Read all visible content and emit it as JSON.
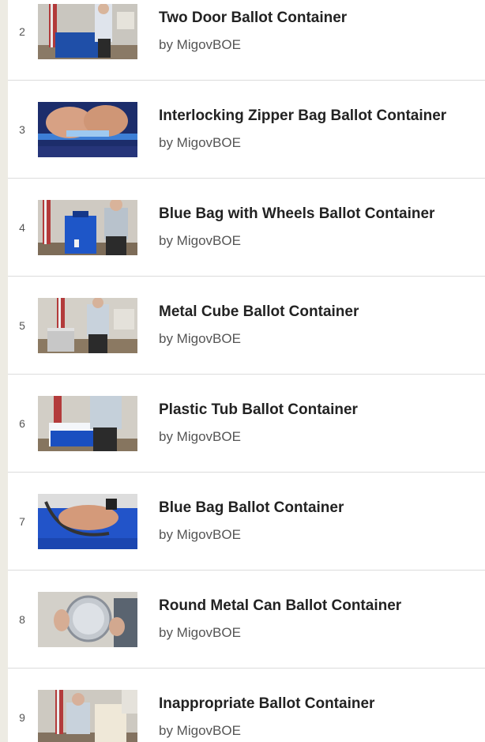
{
  "playlist": {
    "items": [
      {
        "index": "2",
        "title": "Two Door Ballot Container",
        "author": "by MigovBOE",
        "thumb": "two-door-thumbnail"
      },
      {
        "index": "3",
        "title": "Interlocking Zipper Bag Ballot Container",
        "author": "by MigovBOE",
        "thumb": "zipper-bag-thumbnail"
      },
      {
        "index": "4",
        "title": "Blue Bag with Wheels Ballot Container",
        "author": "by MigovBOE",
        "thumb": "blue-bag-wheels-thumbnail"
      },
      {
        "index": "5",
        "title": "Metal Cube Ballot Container",
        "author": "by MigovBOE",
        "thumb": "metal-cube-thumbnail"
      },
      {
        "index": "6",
        "title": "Plastic Tub Ballot Container",
        "author": "by MigovBOE",
        "thumb": "plastic-tub-thumbnail"
      },
      {
        "index": "7",
        "title": "Blue Bag Ballot Container",
        "author": "by MigovBOE",
        "thumb": "blue-bag-thumbnail"
      },
      {
        "index": "8",
        "title": "Round Metal Can Ballot Container",
        "author": "by MigovBOE",
        "thumb": "round-metal-can-thumbnail"
      },
      {
        "index": "9",
        "title": "Inappropriate Ballot Container",
        "author": "by MigovBOE",
        "thumb": "inappropriate-container-thumbnail"
      }
    ]
  },
  "colors": {
    "page_background": "#edebe3",
    "list_background": "#ffffff",
    "title_text": "#222222",
    "byline_text": "#555555",
    "divider": "#dcdcdc"
  }
}
